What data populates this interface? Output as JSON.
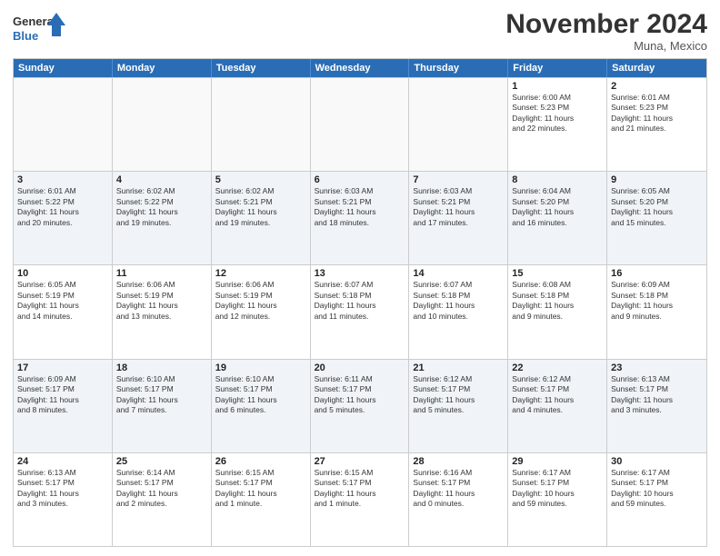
{
  "header": {
    "logo_line1": "General",
    "logo_line2": "Blue",
    "month": "November 2024",
    "location": "Muna, Mexico"
  },
  "calendar": {
    "days_of_week": [
      "Sunday",
      "Monday",
      "Tuesday",
      "Wednesday",
      "Thursday",
      "Friday",
      "Saturday"
    ],
    "rows": [
      [
        {
          "day": "",
          "info": "",
          "empty": true
        },
        {
          "day": "",
          "info": "",
          "empty": true
        },
        {
          "day": "",
          "info": "",
          "empty": true
        },
        {
          "day": "",
          "info": "",
          "empty": true
        },
        {
          "day": "",
          "info": "",
          "empty": true
        },
        {
          "day": "1",
          "info": "Sunrise: 6:00 AM\nSunset: 5:23 PM\nDaylight: 11 hours\nand 22 minutes."
        },
        {
          "day": "2",
          "info": "Sunrise: 6:01 AM\nSunset: 5:23 PM\nDaylight: 11 hours\nand 21 minutes."
        }
      ],
      [
        {
          "day": "3",
          "info": "Sunrise: 6:01 AM\nSunset: 5:22 PM\nDaylight: 11 hours\nand 20 minutes."
        },
        {
          "day": "4",
          "info": "Sunrise: 6:02 AM\nSunset: 5:22 PM\nDaylight: 11 hours\nand 19 minutes."
        },
        {
          "day": "5",
          "info": "Sunrise: 6:02 AM\nSunset: 5:21 PM\nDaylight: 11 hours\nand 19 minutes."
        },
        {
          "day": "6",
          "info": "Sunrise: 6:03 AM\nSunset: 5:21 PM\nDaylight: 11 hours\nand 18 minutes."
        },
        {
          "day": "7",
          "info": "Sunrise: 6:03 AM\nSunset: 5:21 PM\nDaylight: 11 hours\nand 17 minutes."
        },
        {
          "day": "8",
          "info": "Sunrise: 6:04 AM\nSunset: 5:20 PM\nDaylight: 11 hours\nand 16 minutes."
        },
        {
          "day": "9",
          "info": "Sunrise: 6:05 AM\nSunset: 5:20 PM\nDaylight: 11 hours\nand 15 minutes."
        }
      ],
      [
        {
          "day": "10",
          "info": "Sunrise: 6:05 AM\nSunset: 5:19 PM\nDaylight: 11 hours\nand 14 minutes."
        },
        {
          "day": "11",
          "info": "Sunrise: 6:06 AM\nSunset: 5:19 PM\nDaylight: 11 hours\nand 13 minutes."
        },
        {
          "day": "12",
          "info": "Sunrise: 6:06 AM\nSunset: 5:19 PM\nDaylight: 11 hours\nand 12 minutes."
        },
        {
          "day": "13",
          "info": "Sunrise: 6:07 AM\nSunset: 5:18 PM\nDaylight: 11 hours\nand 11 minutes."
        },
        {
          "day": "14",
          "info": "Sunrise: 6:07 AM\nSunset: 5:18 PM\nDaylight: 11 hours\nand 10 minutes."
        },
        {
          "day": "15",
          "info": "Sunrise: 6:08 AM\nSunset: 5:18 PM\nDaylight: 11 hours\nand 9 minutes."
        },
        {
          "day": "16",
          "info": "Sunrise: 6:09 AM\nSunset: 5:18 PM\nDaylight: 11 hours\nand 9 minutes."
        }
      ],
      [
        {
          "day": "17",
          "info": "Sunrise: 6:09 AM\nSunset: 5:17 PM\nDaylight: 11 hours\nand 8 minutes."
        },
        {
          "day": "18",
          "info": "Sunrise: 6:10 AM\nSunset: 5:17 PM\nDaylight: 11 hours\nand 7 minutes."
        },
        {
          "day": "19",
          "info": "Sunrise: 6:10 AM\nSunset: 5:17 PM\nDaylight: 11 hours\nand 6 minutes."
        },
        {
          "day": "20",
          "info": "Sunrise: 6:11 AM\nSunset: 5:17 PM\nDaylight: 11 hours\nand 5 minutes."
        },
        {
          "day": "21",
          "info": "Sunrise: 6:12 AM\nSunset: 5:17 PM\nDaylight: 11 hours\nand 5 minutes."
        },
        {
          "day": "22",
          "info": "Sunrise: 6:12 AM\nSunset: 5:17 PM\nDaylight: 11 hours\nand 4 minutes."
        },
        {
          "day": "23",
          "info": "Sunrise: 6:13 AM\nSunset: 5:17 PM\nDaylight: 11 hours\nand 3 minutes."
        }
      ],
      [
        {
          "day": "24",
          "info": "Sunrise: 6:13 AM\nSunset: 5:17 PM\nDaylight: 11 hours\nand 3 minutes."
        },
        {
          "day": "25",
          "info": "Sunrise: 6:14 AM\nSunset: 5:17 PM\nDaylight: 11 hours\nand 2 minutes."
        },
        {
          "day": "26",
          "info": "Sunrise: 6:15 AM\nSunset: 5:17 PM\nDaylight: 11 hours\nand 1 minute."
        },
        {
          "day": "27",
          "info": "Sunrise: 6:15 AM\nSunset: 5:17 PM\nDaylight: 11 hours\nand 1 minute."
        },
        {
          "day": "28",
          "info": "Sunrise: 6:16 AM\nSunset: 5:17 PM\nDaylight: 11 hours\nand 0 minutes."
        },
        {
          "day": "29",
          "info": "Sunrise: 6:17 AM\nSunset: 5:17 PM\nDaylight: 10 hours\nand 59 minutes."
        },
        {
          "day": "30",
          "info": "Sunrise: 6:17 AM\nSunset: 5:17 PM\nDaylight: 10 hours\nand 59 minutes."
        }
      ]
    ]
  }
}
